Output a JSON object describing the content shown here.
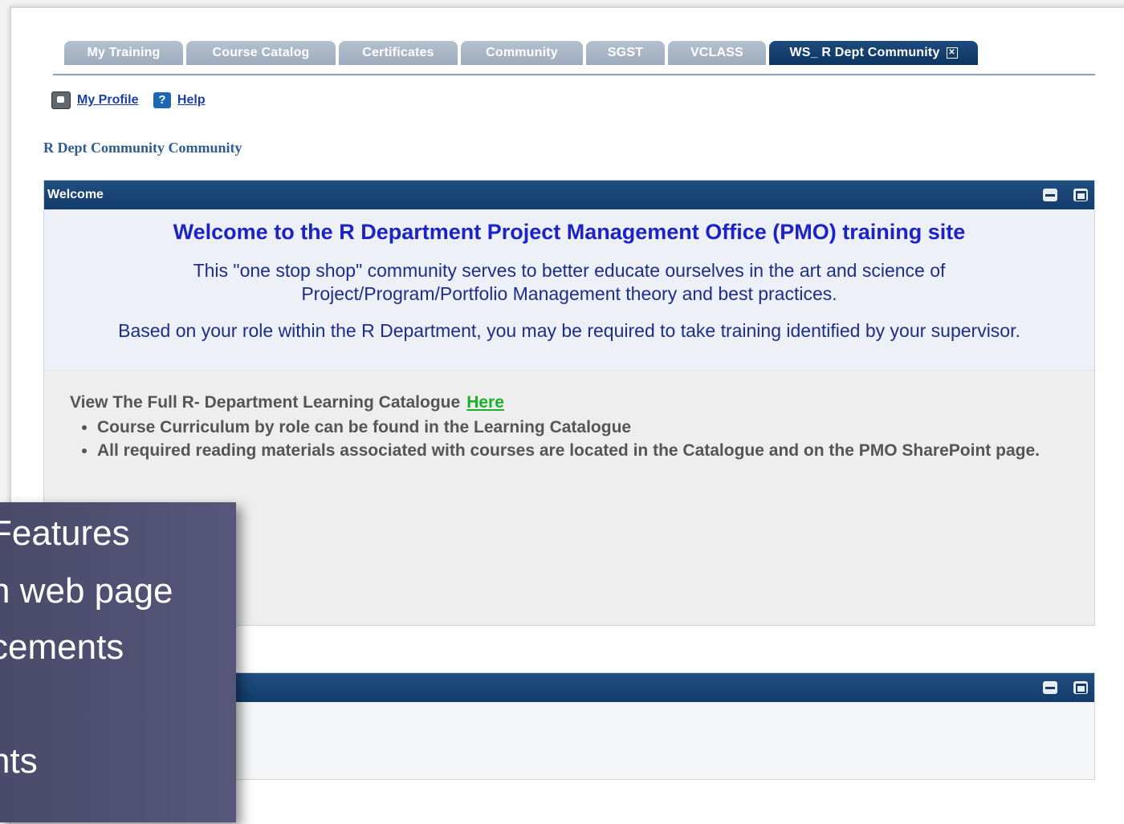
{
  "tabs": [
    {
      "label": "My Training"
    },
    {
      "label": "Course Catalog"
    },
    {
      "label": "Certificates"
    },
    {
      "label": "Community"
    },
    {
      "label": "SGST"
    },
    {
      "label": "VCLASS"
    },
    {
      "label": "WS_ R Dept Community",
      "active": true
    }
  ],
  "links": {
    "profile": "My Profile",
    "help": "Help"
  },
  "community_title": "R Dept Community Community",
  "welcome_panel": {
    "title": "Welcome",
    "heading": "Welcome to the R Department Project Management Office (PMO) training site",
    "paragraph1": "This \"one stop shop\" community serves to better educate ourselves in the art and science of Project/Program/Portfolio Management theory and best practices.",
    "paragraph2": "Based on your role within the R Department, you may be required to take training identified by your supervisor."
  },
  "catalog": {
    "intro": "View The Full  R- Department Learning Catalogue",
    "link": "Here",
    "bullets": [
      "Course Curriculum by role can be found in the Learning Catalogue",
      "All required reading materials associated with courses are located in the Catalogue and on the PMO SharePoint page."
    ]
  },
  "overlay": {
    "lines": [
      "Features",
      "n web page",
      "cements",
      "nts"
    ]
  },
  "colors": {
    "tab_active": "#0d3462",
    "panel_header": "#133c6b",
    "heading_blue": "#1a22c8",
    "link_green": "#19b02a",
    "overlay": "#4e4e70"
  }
}
